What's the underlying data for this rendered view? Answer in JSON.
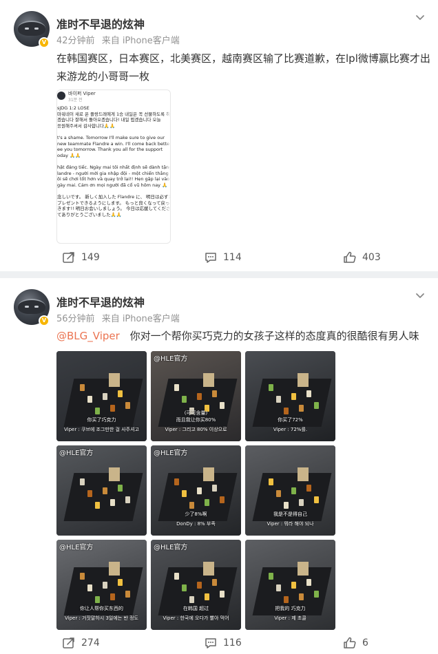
{
  "posts": [
    {
      "username": "准时不早退的炫神",
      "time": "42分钟前",
      "source": "来自 iPhone客户端",
      "text": "在韩国赛区，日本赛区，北美赛区，越南赛区输了比赛道歉，在lpl微博赢比赛才出来游龙的小哥哥一枚",
      "embed": {
        "name": "바이퍼 Viper",
        "time": "31분 전",
        "body": "sJDG 1:2 LOSE\n마워네이 새로 온 플랑드레에게 1승 내일은 꼭 선물하도록 하\n겠습니다 잘해서 돌아오겠습니다! 내일 뵙겠습니다 오늘\n응원해주셔서 감사합니다🙏🙏\n\nt's a shame. Tomorrow I'll make sure to give our\nnew teammate Flandre a win. I'll come back better!\nee you tomorrow. Thank you all for the support\noday 🙏🙏\n\nhật đáng tiếc. Ngày mai tôi nhất định sẽ dành tặng\nlandre - người mới gia nhập đội - một chiến thắng\nôi sẽ chơi tốt hơn và quay trở lại!! Hẹn gặp lại vào\ngày mai. Cảm ơn mọi người đã cổ vũ hôm nay 🙏\n\n 念しいです。 新しく加入した Flandre に、 明日は必ず1勝\nプレゼントできるようにします。 もっと良くなって戻っ\nきます!! 明日お会いしましょう。 今日は応援してくださ\nてありがとうございました🙏🙏"
      },
      "actions": {
        "repost": "149",
        "comment": "114",
        "like": "403"
      }
    },
    {
      "username": "准时不早退的炫神",
      "time": "56分钟前",
      "source": "来自 iPhone客户端",
      "mention": "@BLG_Viper",
      "text": "你对一个帮你买巧克力的女孩子这样的态度真的很酷很有男人味",
      "images": [
        {
          "wm": "",
          "sub1": "你买了巧克力",
          "sub2": "Viper : 쿠브에 조그만한 걸 사주셔고"
        },
        {
          "wm": "@HLE官方",
          "sub1": "(可可含量)\n而且我让你买80%",
          "sub2": "Viper : 그리고 80% 이상으로"
        },
        {
          "wm": "",
          "sub1": "你买了72%",
          "sub2": "Viper : 72%를."
        },
        {
          "wm": "@HLE官方",
          "sub1": "",
          "sub2": ""
        },
        {
          "wm": "@HLE官方",
          "sub1": "少了8%啊",
          "sub2": "DonDy : 8% 부족"
        },
        {
          "wm": "",
          "sub1": "我是不是得自己",
          "sub2": "Viper : 뭐라 해야 되나"
        },
        {
          "wm": "@HLE官方",
          "sub1": "你让人帮你买东西的",
          "sub2": "Viper : 거짓말하시 3일에는 반 정도"
        },
        {
          "wm": "@HLE官方",
          "sub1": "在韩国 超过",
          "sub2": "Viper : 한국에 오다가 빨아 먹어"
        },
        {
          "wm": "",
          "sub1": "把我的 巧克力",
          "sub2": "Viper : 제 초콜"
        }
      ],
      "actions": {
        "repost": "274",
        "comment": "116",
        "like": "6"
      }
    }
  ],
  "icons": {
    "repost": "repost-icon",
    "comment": "comment-icon",
    "like": "like-icon",
    "more": "chevron-down-icon",
    "verified": "verified-badge-icon"
  },
  "colors": {
    "mention": "#eb7350",
    "meta": "#939393",
    "badge": "#f7b500"
  }
}
